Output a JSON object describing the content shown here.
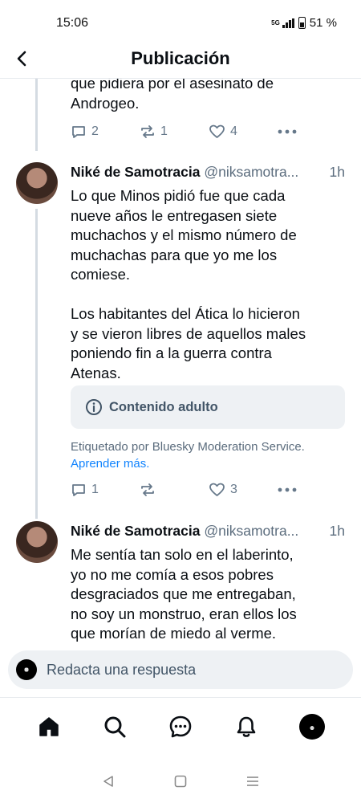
{
  "status": {
    "time": "15:06",
    "network": "5G",
    "battery": "51 %"
  },
  "header": {
    "title": "Publicación"
  },
  "post0": {
    "text_lines": [
      "que pidiera por el asesinato de",
      "Androgeo."
    ],
    "replies": "2",
    "reposts": "1",
    "likes": "4"
  },
  "post1": {
    "author": "Niké de Samotracia",
    "handle": "@niksamotra...",
    "time": "1h",
    "text_lines": [
      "Lo que Minos pidió fue que cada",
      "nueve años le entregasen siete",
      "muchachos y el mismo número de",
      "muchachas para que yo me los",
      "comiese.",
      "",
      "Los habitantes del Ática lo hicieron",
      "y se vieron libres de aquellos males",
      "poniendo fin a la guerra contra",
      "Atenas."
    ],
    "warning": "Contenido adulto",
    "moderation_text": "Etiquetado por Bluesky Moderation Service.",
    "moderation_link": "Aprender más.",
    "replies": "1",
    "reposts": "",
    "likes": "3"
  },
  "post2": {
    "author": "Niké de Samotracia",
    "handle": "@niksamotra...",
    "time": "1h",
    "text_lines": [
      "Me sentía tan solo en el laberinto,",
      "yo no me comía a esos pobres",
      "desgraciados que me entregaban,",
      "no soy un monstruo, eran ellos los",
      "que morían de miedo al verme."
    ]
  },
  "reply_bar": {
    "placeholder": "Redacta una respuesta"
  },
  "tabs": [
    "home-icon",
    "search-icon",
    "chat-icon",
    "bell-icon",
    "profile-avatar"
  ],
  "colors": {
    "accent": "#1083fe",
    "muted": "#66788a",
    "thread_line": "#d4dbe2",
    "box_bg": "#eef1f4"
  }
}
